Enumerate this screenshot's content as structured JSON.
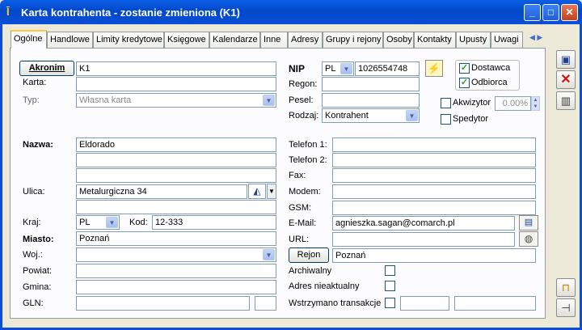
{
  "window": {
    "title": "Karta kontrahenta - zostanie zmieniona (K1)"
  },
  "tabs": [
    "Ogólne",
    "Handlowe",
    "Limity kredytowe",
    "Księgowe",
    "Kalendarze",
    "Inne",
    "Adresy",
    "Grupy i rejony",
    "Osoby",
    "Kontakty",
    "Upusty",
    "Uwagi"
  ],
  "form": {
    "akronim_button": "Akronim",
    "akronim_value": "K1",
    "karta_label": "Karta:",
    "karta_value": "",
    "typ_label": "Typ:",
    "typ_value": "Własna karta",
    "nazwa_label": "Nazwa:",
    "nazwa_lines": [
      "Eldorado",
      "",
      ""
    ],
    "ulica_label": "Ulica:",
    "ulica_value": "Metalurgiczna 34",
    "ulica_line2": "",
    "kraj_label": "Kraj:",
    "kraj_value": "PL",
    "kod_label": "Kod:",
    "kod_value": "12-333",
    "miasto_label": "Miasto:",
    "miasto_value": "Poznań",
    "woj_label": "Woj.:",
    "woj_value": "",
    "powiat_label": "Powiat:",
    "powiat_value": "",
    "gmina_label": "Gmina:",
    "gmina_value": "",
    "gln_label": "GLN:",
    "gln_value": "",
    "gln_check": ""
  },
  "right": {
    "nip_label": "NIP",
    "nip_prefix": "PL",
    "nip_value": "1026554748",
    "regon_label": "Regon:",
    "regon_value": "",
    "pesel_label": "Pesel:",
    "pesel_value": "",
    "rodzaj_label": "Rodzaj:",
    "rodzaj_value": "Kontrahent",
    "dostawca_label": "Dostawca",
    "odbiorca_label": "Odbiorca",
    "akwizytor_label": "Akwizytor",
    "akwizytor_pct": "0.00%",
    "spedytor_label": "Spedytor",
    "telefon1_label": "Telefon 1:",
    "telefon1_value": "",
    "telefon2_label": "Telefon 2:",
    "telefon2_value": "",
    "fax_label": "Fax:",
    "fax_value": "",
    "modem_label": "Modem:",
    "modem_value": "",
    "gsm_label": "GSM:",
    "gsm_value": "",
    "email_label": "E-Mail:",
    "email_value": "agnieszka.sagan@comarch.pl",
    "url_label": "URL:",
    "url_value": "",
    "rejon_button": "Rejon",
    "rejon_value": "Poznań",
    "archiwalny_label": "Archiwalny",
    "adres_label": "Adres nieaktualny",
    "wstrzymano_label": "Wstrzymano transakcje",
    "wstrzymano_v1": "",
    "wstrzymano_v2": ""
  },
  "colors": {
    "titlebar": "#0a4fd6",
    "tab_highlight": "#ffc83c",
    "check": "#21a121"
  },
  "icons": [
    "lightning-icon",
    "save-icon",
    "delete-icon",
    "book-icon",
    "lock-icon",
    "pin-icon",
    "email-card-icon",
    "globe-search-icon",
    "map-icon",
    "app-icon"
  ]
}
